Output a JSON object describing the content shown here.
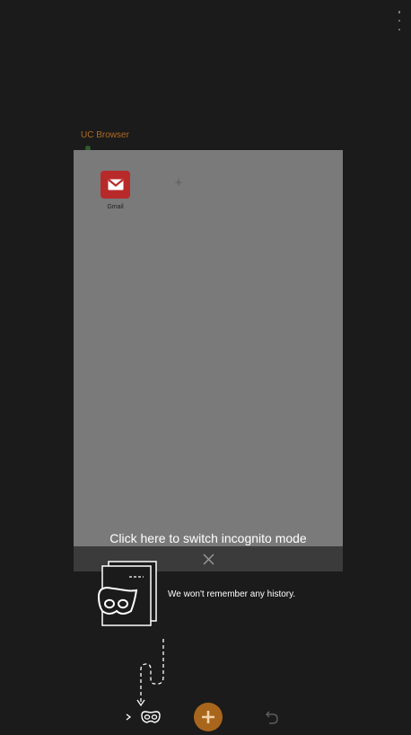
{
  "card": {
    "title": "UC Browser",
    "shortcuts": [
      {
        "label": "Gmail",
        "icon": "gmail-icon"
      }
    ],
    "add_icon": "plus-icon"
  },
  "tip": {
    "title": "Click here to switch incognito mode",
    "description": "We won't remember any history."
  },
  "bottom_bar": {
    "incognito_icon": "incognito-mask-icon",
    "new_tab_icon": "plus-icon",
    "back_icon": "undo-icon"
  },
  "colors": {
    "background": "#1b1b1b",
    "card_background": "#7a7a7a",
    "accent": "#a8651c",
    "gmail_red": "#b82a2a"
  }
}
